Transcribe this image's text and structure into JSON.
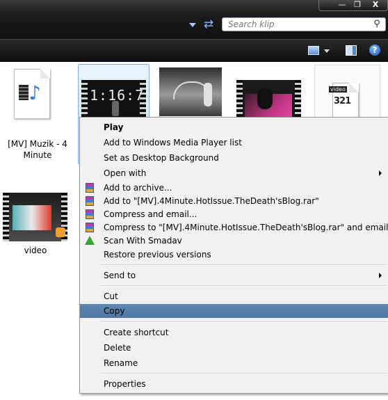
{
  "window": {
    "min_glyph": "—",
    "max_glyph": "❐",
    "close_glyph": "X"
  },
  "search": {
    "placeholder": "Search klip"
  },
  "files": [
    {
      "name": "[MV] Muzik - 4 Minute",
      "type": "audio-file"
    },
    {
      "name": "",
      "type": "video-thumbnail",
      "thumb_text": "1:16:7"
    },
    {
      "name": "",
      "type": "video-thumbnail"
    },
    {
      "name": "",
      "type": "video-thumbnail"
    },
    {
      "name": "",
      "type": "media-player-classic-file",
      "badge": "video",
      "badge_digits": "321"
    },
    {
      "name": "video",
      "type": "video-thumbnail"
    }
  ],
  "context_menu": {
    "items": [
      {
        "label": "Play",
        "bold": true
      },
      {
        "label": "Add to Windows Media Player list"
      },
      {
        "label": "Set as Desktop Background"
      },
      {
        "label": "Open with",
        "submenu": true
      },
      {
        "label": "Add to archive...",
        "icon": "winrar-icon"
      },
      {
        "label": "Add to \"[MV].4Minute.HotIssue.TheDeath'sBlog.rar\"",
        "icon": "winrar-icon"
      },
      {
        "label": "Compress and email...",
        "icon": "winrar-icon"
      },
      {
        "label": "Compress to \"[MV].4Minute.HotIssue.TheDeath'sBlog.rar\" and email",
        "icon": "winrar-icon"
      },
      {
        "label": "Scan With Smadav",
        "icon": "smadav-icon"
      },
      {
        "label": "Restore previous versions"
      },
      {
        "label": "Send to",
        "submenu": true
      },
      {
        "label": "Cut"
      },
      {
        "label": "Copy",
        "highlighted": true
      },
      {
        "label": "Create shortcut"
      },
      {
        "label": "Delete"
      },
      {
        "label": "Rename"
      },
      {
        "label": "Properties"
      }
    ]
  },
  "colors": {
    "menu_highlight": "#5a83af",
    "selection": "#cfe4fa",
    "chrome": "#101010"
  }
}
